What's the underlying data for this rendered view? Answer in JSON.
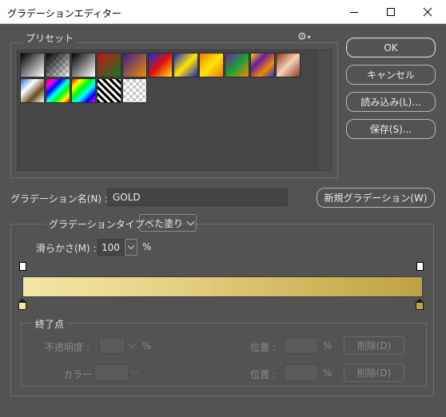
{
  "window": {
    "title": "グラデーションエディター",
    "minimize_glyph": "—",
    "maximize_glyph": "☐",
    "close_glyph": "✕"
  },
  "presets": {
    "label": "プリセット",
    "gear_glyph": "⚙",
    "gear_menu_glyph": "▾",
    "swatches": [
      {
        "name": "black-to-white",
        "colors": [
          "#000000",
          "#ffffff"
        ]
      },
      {
        "name": "foreground-to-transparent",
        "colors": [
          "#000000",
          "transparent"
        ]
      },
      {
        "name": "black-white",
        "colors": [
          "#000000",
          "#ffffff"
        ]
      },
      {
        "name": "red-green",
        "colors": [
          "#c41616",
          "#157a22"
        ]
      },
      {
        "name": "violet-orange",
        "colors": [
          "#3a1f8e",
          "#f08a00"
        ]
      },
      {
        "name": "blue-red-yellow",
        "colors": [
          "#0c2fd6",
          "#e21010",
          "#ffe600"
        ]
      },
      {
        "name": "blue-yellow-blue",
        "colors": [
          "#1623c8",
          "#ffe600",
          "#1623c8"
        ]
      },
      {
        "name": "orange-yellow-orange",
        "colors": [
          "#f07a00",
          "#ffe600",
          "#f07a00"
        ]
      },
      {
        "name": "violet-green-orange",
        "colors": [
          "#7a1aa0",
          "#18a03a",
          "#f08a00"
        ]
      },
      {
        "name": "yellow-violet-orange-blue",
        "colors": [
          "#ffd400",
          "#6a1aa0",
          "#f08a00",
          "#1a3ad0"
        ]
      },
      {
        "name": "copper",
        "colors": [
          "#8a3a1a",
          "#f5d0b8",
          "#8a3a1a"
        ]
      },
      {
        "name": "chrome",
        "colors": [
          "#1a6ad0",
          "#ffffff",
          "#6a4a1a",
          "#ffffff"
        ]
      },
      {
        "name": "spectrum",
        "colors": [
          "#ff0000",
          "#ff00ff",
          "#0000ff",
          "#00ffff",
          "#00ff00",
          "#ffff00",
          "#ff0000"
        ]
      },
      {
        "name": "transparent-rainbow",
        "colors": [
          "#ff0000",
          "#ffff00",
          "#00ff00",
          "#00ffff",
          "#0000ff",
          "#ff00ff"
        ]
      },
      {
        "name": "transparent-stripes",
        "colors": [
          "#000000",
          "#ffffff"
        ]
      },
      {
        "name": "neutral-density",
        "colors": [
          "transparent"
        ]
      }
    ]
  },
  "buttons": {
    "ok": "OK",
    "cancel": "キャンセル",
    "load": "読み込み(L)...",
    "save": "保存(S)...",
    "new_gradient": "新規グラデーション(W)"
  },
  "gradient": {
    "name_label": "グラデーション名(N) :",
    "name_value": "GOLD",
    "type_label": "グラデーションタイプ :",
    "type_value": "べた塗り",
    "smoothness_label": "滑らかさ(M) :",
    "smoothness_value": "100",
    "smoothness_unit": "%",
    "bar_colors": [
      "#f3e7a6",
      "#bfa245"
    ],
    "left_stop_color": "#f3e7a6",
    "right_stop_color": "#bfa245"
  },
  "stops": {
    "label": "終了点",
    "opacity_label": "不透明度 :",
    "opacity_unit": "%",
    "color_label": "カラー :",
    "location_label": "位置 :",
    "location_unit": "%",
    "delete_label": "削除(D)"
  }
}
